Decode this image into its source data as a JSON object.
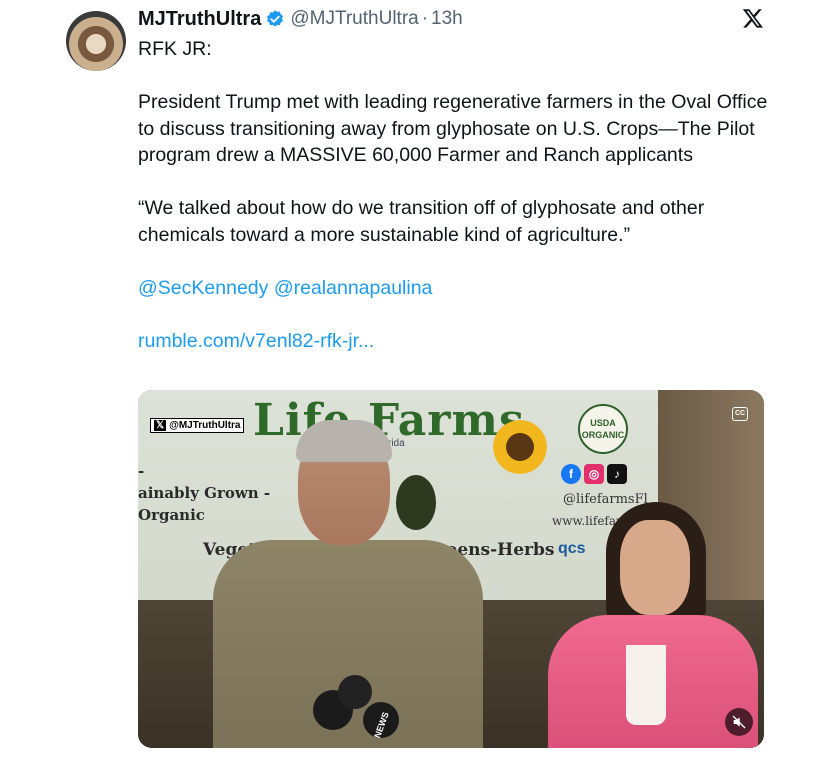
{
  "tweet": {
    "author_name": "MJTruthUltra",
    "handle": "@MJTruthUltra",
    "separator": "·",
    "time": "13h",
    "lines": [
      "RFK JR:",
      "President Trump met with leading regenerative farmers in the Oval Office to discuss transitioning away from  glyphosate on U.S. Crops—The Pilot program drew a MASSIVE 60,000 Farmer and Ranch applicants",
      "“We talked about how do we transition off of glyphosate and other chemicals toward a more sustainable kind of agriculture.”"
    ],
    "mentions": [
      "@SecKennedy",
      "@realannapaulina"
    ],
    "link": "rumble.com/v7enl82-rfk-jr..."
  },
  "media": {
    "watermark": "@MJTruthUltra",
    "sign_title": "Life Farms",
    "sign_sub": "rida",
    "sign_left_1": "-",
    "sign_left_2": "ainably Grown -",
    "sign_left_3": "Organic",
    "sign_bottom_a": "Vegetabl",
    "sign_bottom_b": "rogreens-Herbs",
    "usda_1": "USDA",
    "usda_2": "ORGANIC",
    "social_handle": "@lifefarmsFl",
    "website": "www.lifefarm",
    "qcs": "qcs",
    "mic_label": "NEWS",
    "cc_label": "CC"
  },
  "colors": {
    "accent": "#1d9bf0",
    "secondary_text": "#536471",
    "verified": "#1d9bf0"
  },
  "icons": [
    "verified-badge-icon",
    "x-logo-icon",
    "closed-captions-icon",
    "mute-icon"
  ]
}
